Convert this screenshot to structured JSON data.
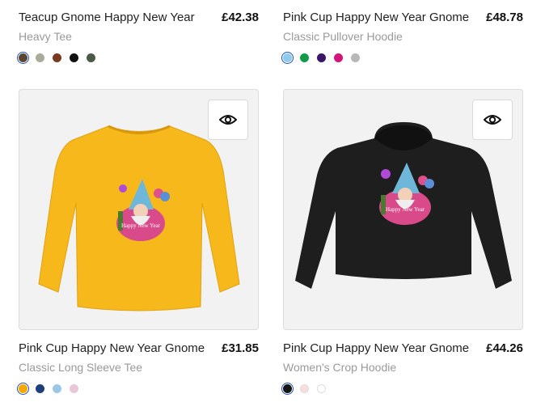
{
  "products": [
    {
      "title": "Teacup Gnome Happy New Year",
      "price": "£42.38",
      "subtitle": "Heavy Tee",
      "swatches": [
        "#5a4632",
        "#a8ad9a",
        "#7a3a20",
        "#111111",
        "#4a5a44"
      ]
    },
    {
      "title": "Pink Cup Happy New Year Gnome",
      "price": "£48.78",
      "subtitle": "Classic Pullover Hoodie",
      "swatches": [
        "#8ecbea",
        "#119a4a",
        "#3a1666",
        "#d4147a",
        "#b8b8b8"
      ]
    },
    {
      "title": "Pink Cup Happy New Year Gnome",
      "price": "£31.85",
      "subtitle": "Classic Long Sleeve Tee",
      "swatches": [
        "#f5a800",
        "#1e3f7a",
        "#9cc6e6",
        "#e8c8d8"
      ],
      "garment_color": "#f7b81c"
    },
    {
      "title": "Pink Cup Happy New Year Gnome",
      "price": "£44.26",
      "subtitle": "Women's Crop Hoodie",
      "swatches": [
        "#151515",
        "#f8dede",
        "#ffffff"
      ],
      "garment_color": "#1e1e1e"
    }
  ],
  "icons": {
    "preview": "eye-icon"
  }
}
